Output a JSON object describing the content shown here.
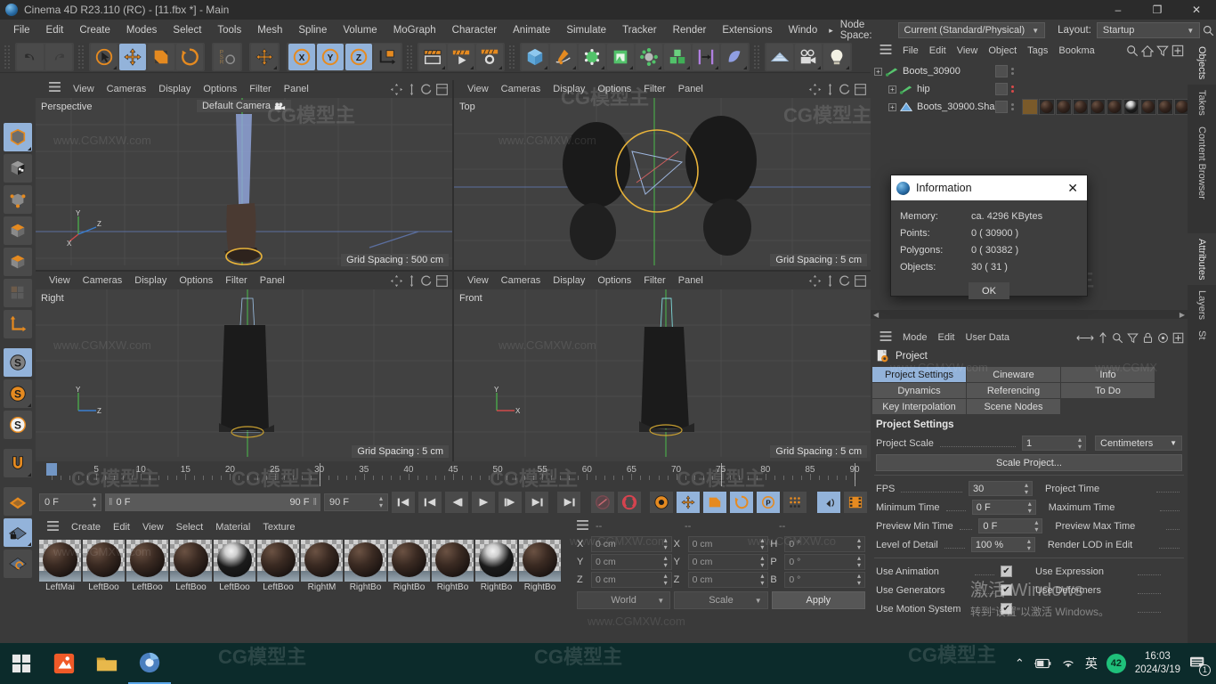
{
  "titlebar": {
    "title": "Cinema 4D R23.110 (RC) - [11.fbx *] - Main",
    "minimize": "–",
    "maximize": "❐",
    "close": "✕"
  },
  "menubar": {
    "items": [
      "File",
      "Edit",
      "Create",
      "Modes",
      "Select",
      "Tools",
      "Mesh",
      "Spline",
      "Volume",
      "MoGraph",
      "Character",
      "Animate",
      "Simulate",
      "Tracker",
      "Render",
      "Extensions",
      "Windo"
    ],
    "overflow_arrow": "▸",
    "node_space_label": "Node Space:",
    "node_space_value": "Current (Standard/Physical)",
    "layout_label": "Layout:",
    "layout_value": "Startup"
  },
  "viewports": [
    {
      "name": "Perspective",
      "camera": "Default Camera",
      "grid": "Grid Spacing : 500 cm",
      "menus": [
        "View",
        "Cameras",
        "Display",
        "Options",
        "Filter",
        "Panel"
      ]
    },
    {
      "name": "Top",
      "camera": "",
      "grid": "Grid Spacing : 5 cm",
      "menus": [
        "View",
        "Cameras",
        "Display",
        "Options",
        "Filter",
        "Panel"
      ]
    },
    {
      "name": "Right",
      "camera": "",
      "grid": "Grid Spacing : 5 cm",
      "menus": [
        "View",
        "Cameras",
        "Display",
        "Options",
        "Filter",
        "Panel"
      ]
    },
    {
      "name": "Front",
      "camera": "",
      "grid": "Grid Spacing : 5 cm",
      "menus": [
        "View",
        "Cameras",
        "Display",
        "Options",
        "Filter",
        "Panel"
      ]
    }
  ],
  "timeline": {
    "ticks": [
      0,
      5,
      10,
      15,
      20,
      25,
      30,
      35,
      40,
      45,
      50,
      55,
      60,
      65,
      70,
      75,
      80,
      85,
      90
    ],
    "current_frame": "0 F",
    "range_start": "0 F",
    "range_end": "90 F",
    "max_frame": "90 F",
    "end_field": "0 F"
  },
  "material_manager": {
    "menus": [
      "Create",
      "Edit",
      "View",
      "Select",
      "Material",
      "Texture"
    ],
    "materials": [
      {
        "name": "LeftMai",
        "kind": "dark"
      },
      {
        "name": "LeftBoo",
        "kind": "dark"
      },
      {
        "name": "LeftBoo",
        "kind": "dark"
      },
      {
        "name": "LeftBoo",
        "kind": "dark"
      },
      {
        "name": "LeftBoo",
        "kind": "white"
      },
      {
        "name": "LeftBoo",
        "kind": "dark"
      },
      {
        "name": "RightM",
        "kind": "dark"
      },
      {
        "name": "RightBo",
        "kind": "dark"
      },
      {
        "name": "RightBo",
        "kind": "dark"
      },
      {
        "name": "RightBo",
        "kind": "dark"
      },
      {
        "name": "RightBo",
        "kind": "white"
      },
      {
        "name": "RightBo",
        "kind": "dark"
      }
    ]
  },
  "coordinates": {
    "headers": [
      "--",
      "--",
      "--"
    ],
    "position": {
      "x_label": "X",
      "x": "0 cm",
      "y_label": "Y",
      "y": "0 cm",
      "z_label": "Z",
      "z": "0 cm"
    },
    "size": {
      "x_label": "X",
      "x": "0 cm",
      "y_label": "Y",
      "y": "0 cm",
      "z_label": "Z",
      "z": "0 cm"
    },
    "rotation": {
      "h_label": "H",
      "h": "0 °",
      "p_label": "P",
      "p": "0 °",
      "b_label": "B",
      "b": "0 °"
    },
    "space": "World",
    "mode": "Scale",
    "apply": "Apply"
  },
  "object_manager": {
    "menus": [
      "File",
      "Edit",
      "View",
      "Object",
      "Tags",
      "Bookma"
    ],
    "rows": [
      {
        "name": "Boots_30900",
        "indent": 0,
        "icon": "bone-icon",
        "dots": "grey",
        "tags": 0
      },
      {
        "name": "hip",
        "indent": 1,
        "icon": "bone-icon",
        "dots": "red",
        "tags": 0
      },
      {
        "name": "Boots_30900.Shape",
        "indent": 1,
        "icon": "polygon-icon",
        "dots": "grey",
        "tags": 9
      }
    ]
  },
  "attribute_manager": {
    "menus": [
      "Mode",
      "Edit",
      "User Data"
    ],
    "object": "Project",
    "tabs": [
      {
        "label": "Project Settings",
        "active": true
      },
      {
        "label": "Cineware",
        "active": false
      },
      {
        "label": "Info",
        "active": false
      },
      {
        "label": "Dynamics",
        "active": false
      },
      {
        "label": "Referencing",
        "active": false
      },
      {
        "label": "To Do",
        "active": false
      },
      {
        "label": "Key Interpolation",
        "active": false
      },
      {
        "label": "Scene Nodes",
        "active": false
      }
    ],
    "section_title": "Project Settings",
    "project_scale_label": "Project Scale",
    "project_scale_value": "1",
    "project_scale_unit": "Centimeters",
    "scale_project_button": "Scale Project...",
    "rows": [
      {
        "label": "FPS",
        "value": "30",
        "right": "Project Time"
      },
      {
        "label": "Minimum Time",
        "value": "0 F",
        "right": "Maximum Time"
      },
      {
        "label": "Preview Min Time",
        "value": "0 F",
        "right": "Preview Max Time"
      },
      {
        "label": "Level of Detail",
        "value": "100 %",
        "right": "Render LOD in Edit"
      }
    ],
    "checkboxes": [
      {
        "label": "Use Animation",
        "checked": true,
        "right": "Use Expression"
      },
      {
        "label": "Use Generators",
        "checked": true,
        "right": "Use Deformers"
      },
      {
        "label": "Use Motion System",
        "checked": true,
        "right": ""
      }
    ],
    "check_mark": "✔"
  },
  "right_tabs_top": [
    "Objects",
    "Takes",
    "Content Browser"
  ],
  "right_tabs_bottom": [
    "Attributes",
    "Layers",
    "St"
  ],
  "information_dialog": {
    "title": "Information",
    "close": "✕",
    "rows": [
      {
        "key": "Memory:",
        "value": "ca. 4296 KBytes"
      },
      {
        "key": "Points:",
        "value": "0 ( 30900 )"
      },
      {
        "key": "Polygons:",
        "value": "0 ( 30382 )"
      },
      {
        "key": "Objects:",
        "value": "30 ( 31 )"
      }
    ],
    "ok": "OK"
  },
  "activate_windows": {
    "line1": "激活 Windows",
    "line2": "转到“设置”以激活 Windows。"
  },
  "watermark": {
    "site": "www.CGMXW.com",
    "brand": "CG模型主"
  },
  "taskbar": {
    "time": "16:03",
    "date": "2024/3/19",
    "ime": "英",
    "badge": "42",
    "notif": "1",
    "chevron": "⌃"
  },
  "colors": {
    "accent_blue": "#93b3da",
    "orange": "#e58a20",
    "panel": "#3a3a3a",
    "taskbar": "#0c2b2b",
    "green": "#1fc07a"
  }
}
